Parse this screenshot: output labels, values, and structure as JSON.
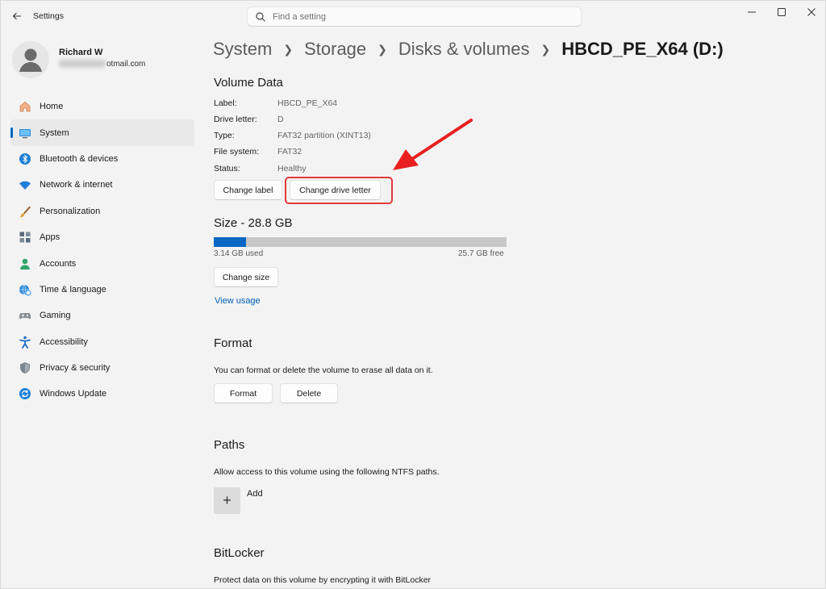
{
  "app": {
    "title": "Settings"
  },
  "search": {
    "placeholder": "Find a setting"
  },
  "user": {
    "name": "Richard W",
    "email_visible": "otmail.com"
  },
  "sidebar": {
    "items": [
      {
        "label": "Home",
        "icon": "home-icon",
        "active": false
      },
      {
        "label": "System",
        "icon": "system-icon",
        "active": true
      },
      {
        "label": "Bluetooth & devices",
        "icon": "bluetooth-icon",
        "active": false
      },
      {
        "label": "Network & internet",
        "icon": "network-icon",
        "active": false
      },
      {
        "label": "Personalization",
        "icon": "brush-icon",
        "active": false
      },
      {
        "label": "Apps",
        "icon": "apps-icon",
        "active": false
      },
      {
        "label": "Accounts",
        "icon": "accounts-icon",
        "active": false
      },
      {
        "label": "Time & language",
        "icon": "globe-clock-icon",
        "active": false
      },
      {
        "label": "Gaming",
        "icon": "gamepad-icon",
        "active": false
      },
      {
        "label": "Accessibility",
        "icon": "accessibility-icon",
        "active": false
      },
      {
        "label": "Privacy & security",
        "icon": "shield-icon",
        "active": false
      },
      {
        "label": "Windows Update",
        "icon": "update-icon",
        "active": false
      }
    ]
  },
  "breadcrumb": {
    "items": [
      "System",
      "Storage",
      "Disks & volumes"
    ],
    "current": "HBCD_PE_X64 (D:)"
  },
  "volume": {
    "heading": "Volume Data",
    "fields": [
      {
        "key": "Label:",
        "value": "HBCD_PE_X64"
      },
      {
        "key": "Drive letter:",
        "value": "D"
      },
      {
        "key": "Type:",
        "value": "FAT32 partition (XINT13)"
      },
      {
        "key": "File system:",
        "value": "FAT32"
      },
      {
        "key": "Status:",
        "value": "Healthy"
      }
    ],
    "change_label": "Change label",
    "change_drive_letter": "Change drive letter"
  },
  "size": {
    "heading": "Size - 28.8 GB",
    "used": "3.14 GB used",
    "free": "25.7 GB free",
    "used_fraction": 0.109,
    "change_size": "Change size",
    "view_usage": "View usage"
  },
  "format": {
    "heading": "Format",
    "description": "You can format or delete the volume to erase all data on it.",
    "format_label": "Format",
    "delete_label": "Delete"
  },
  "paths": {
    "heading": "Paths",
    "description": "Allow access to this volume using the following NTFS paths.",
    "add_label": "Add"
  },
  "bitlocker": {
    "heading": "BitLocker",
    "description": "Protect data on this volume by encrypting it with BitLocker"
  },
  "colors": {
    "accent": "#0067c0",
    "annotation": "#e03a3a",
    "bar_fill": "#0a67c4",
    "bar_track": "#c8c8c8"
  }
}
